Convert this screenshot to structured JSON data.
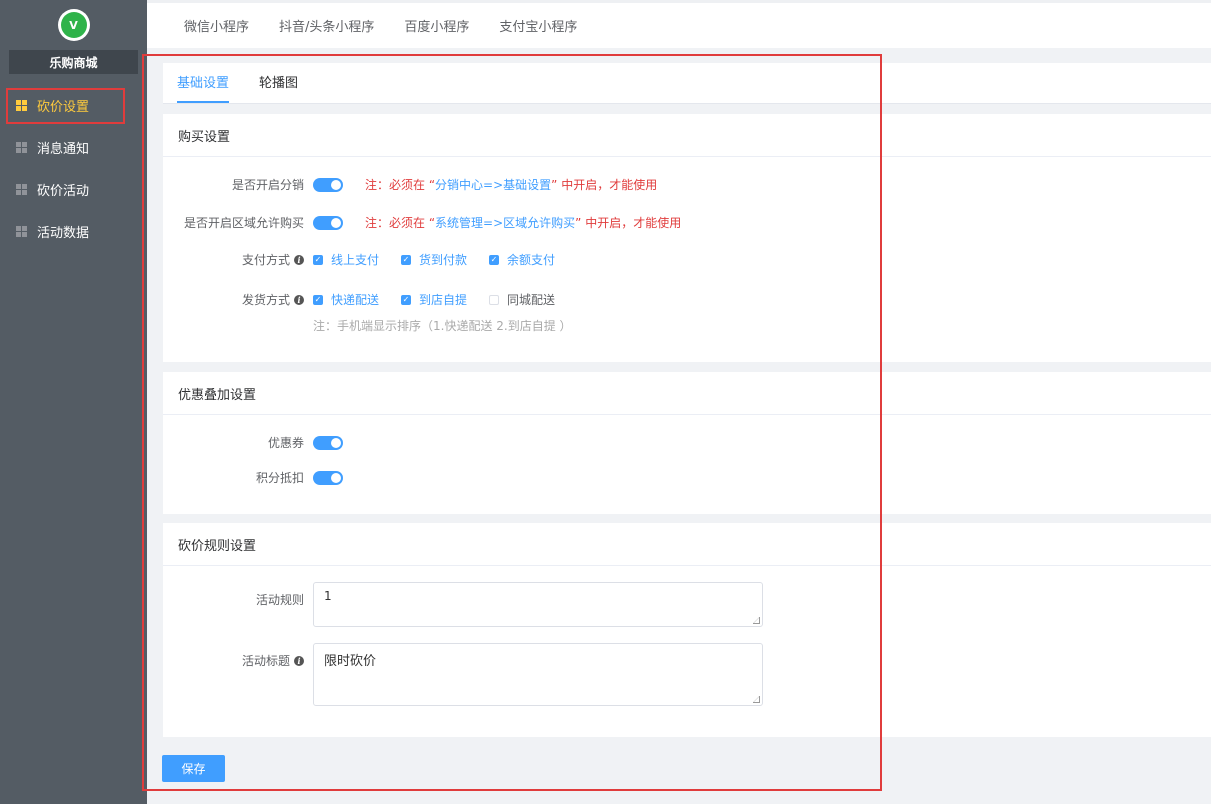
{
  "sidebar": {
    "logo_text": "V",
    "store_name": "乐购商城",
    "items": [
      {
        "label": "砍价设置",
        "active": true
      },
      {
        "label": "消息通知",
        "active": false
      },
      {
        "label": "砍价活动",
        "active": false
      },
      {
        "label": "活动数据",
        "active": false
      }
    ]
  },
  "topnav": {
    "items": [
      "微信小程序",
      "抖音/头条小程序",
      "百度小程序",
      "支付宝小程序"
    ]
  },
  "tabs": [
    {
      "label": "基础设置",
      "active": true
    },
    {
      "label": "轮播图",
      "active": false
    }
  ],
  "purchase": {
    "title": "购买设置",
    "distribution": {
      "label": "是否开启分销",
      "enabled": true,
      "note_prefix": "注：必须在 “",
      "note_link": "分销中心=>基础设置",
      "note_suffix": "” 中开启，才能使用"
    },
    "region": {
      "label": "是否开启区域允许购买",
      "enabled": true,
      "note_prefix": "注：必须在 “",
      "note_link": "系统管理=>区域允许购买",
      "note_suffix": "” 中开启，才能使用"
    },
    "payment": {
      "label": "支付方式",
      "options": [
        {
          "label": "线上支付",
          "checked": true
        },
        {
          "label": "货到付款",
          "checked": true
        },
        {
          "label": "余额支付",
          "checked": true
        }
      ]
    },
    "delivery": {
      "label": "发货方式",
      "options": [
        {
          "label": "快递配送",
          "checked": true
        },
        {
          "label": "到店自提",
          "checked": true
        },
        {
          "label": "同城配送",
          "checked": false
        }
      ],
      "hint": "注：手机端显示排序（1.快递配送 2.到店自提 ）"
    }
  },
  "discount": {
    "title": "优惠叠加设置",
    "coupon": {
      "label": "优惠券",
      "enabled": true
    },
    "points": {
      "label": "积分抵扣",
      "enabled": true
    }
  },
  "rules": {
    "title": "砍价规则设置",
    "activity_rule": {
      "label": "活动规则",
      "value": "1"
    },
    "activity_title": {
      "label": "活动标题",
      "value": "限时砍价"
    }
  },
  "save_label": "保存",
  "colors": {
    "accent": "#409eff",
    "warning": "#e03c3c",
    "sidebar": "#545c64",
    "active_menu": "#ffcb3d"
  }
}
